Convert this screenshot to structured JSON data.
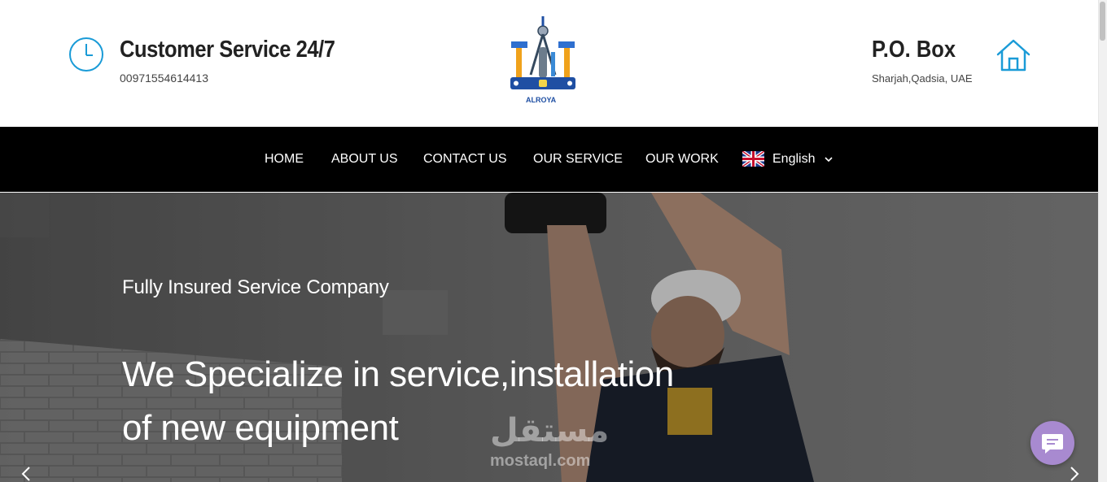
{
  "header": {
    "customer_service_title": "Customer Service 24/7",
    "phone": "00971554614413",
    "logo_text": "ALROYA",
    "po_title": "P.O. Box",
    "address": "Sharjah,Qadsia, UAE"
  },
  "nav": {
    "items": [
      "HOME",
      "ABOUT US",
      "CONTACT US",
      "OUR SERVICE",
      "OUR WORK"
    ],
    "language": "English"
  },
  "hero": {
    "subtitle": "Fully Insured Service Company",
    "title_line1": "We Specialize in service,installation",
    "title_line2": "of new equipment"
  },
  "watermark": {
    "arabic": "مستقل",
    "latin": "mostaql.com"
  },
  "colors": {
    "accent": "#1a9bd7",
    "nav_bg": "#000000",
    "chat_bubble": "#a88ad0",
    "logo_blue": "#1f4fa3"
  }
}
